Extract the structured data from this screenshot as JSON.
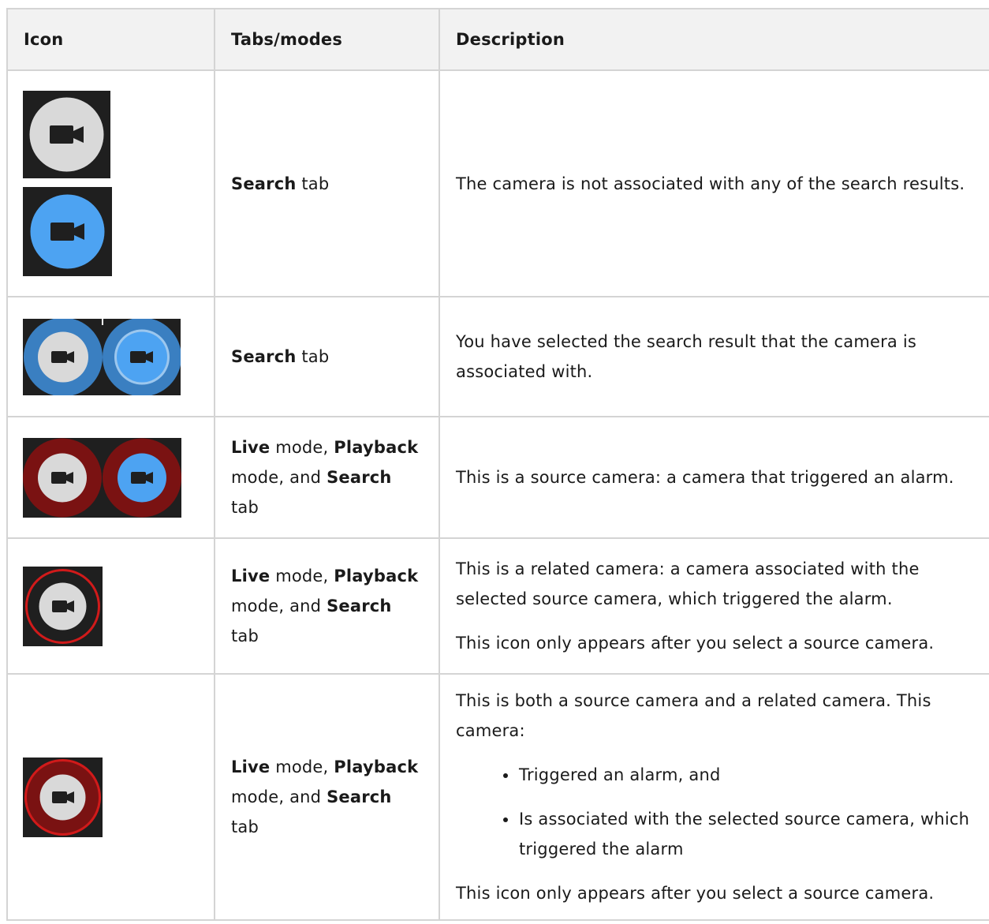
{
  "header": {
    "icon": "Icon",
    "modes": "Tabs/modes",
    "description": "Description"
  },
  "rows": [
    {
      "icons": [
        "camera-gray-icon",
        "camera-blue-icon"
      ],
      "modes": {
        "b1": "Search",
        "t1": " tab"
      },
      "description": "The camera is not associated with any of the search results."
    },
    {
      "icons": [
        "camera-gray-blue-ring-icon",
        "camera-blue-blue-ring-icon"
      ],
      "modes": {
        "b1": "Search",
        "t1": " tab"
      },
      "description": "You have selected the search result that the camera is associated with."
    },
    {
      "icons": [
        "camera-gray-red-ring-icon",
        "camera-blue-red-ring-icon"
      ],
      "modes": {
        "b1": "Live",
        "t1": " mode, ",
        "b2": "Playback",
        "t2": " mode, and ",
        "b3": "Search",
        "t3": " tab"
      },
      "description": "This is a source camera: a camera that triggered an alarm."
    },
    {
      "icons": [
        "camera-gray-red-outline-icon"
      ],
      "modes": {
        "b1": "Live",
        "t1": " mode, ",
        "b2": "Playback",
        "t2": " mode, and ",
        "b3": "Search",
        "t3": " tab"
      },
      "description": "This is a related camera: a camera associated with the selected source camera, which triggered the alarm.",
      "note": "This icon only appears after you select a source camera."
    },
    {
      "icons": [
        "camera-gray-red-ring-outline-icon"
      ],
      "modes": {
        "b1": "Live",
        "t1": " mode, ",
        "b2": "Playback",
        "t2": " mode, and ",
        "b3": "Search",
        "t3": " tab"
      },
      "description": "This is both a source camera and a related camera. This camera:",
      "bullets": [
        "Triggered an alarm, and",
        "Is associated with the selected source camera, which triggered the alarm"
      ],
      "note": "This icon only appears after you select a source camera."
    }
  ],
  "colors": {
    "icon_bg": "#1f1f1f",
    "gray_disc": "#d9d9d9",
    "blue_disc": "#4da3f2",
    "blue_ring": "#3a7fc1",
    "red_ring": "#7a1212",
    "red_outline": "#d11a1a",
    "header_bg": "#f2f2f2",
    "border": "#d4d4d4"
  }
}
